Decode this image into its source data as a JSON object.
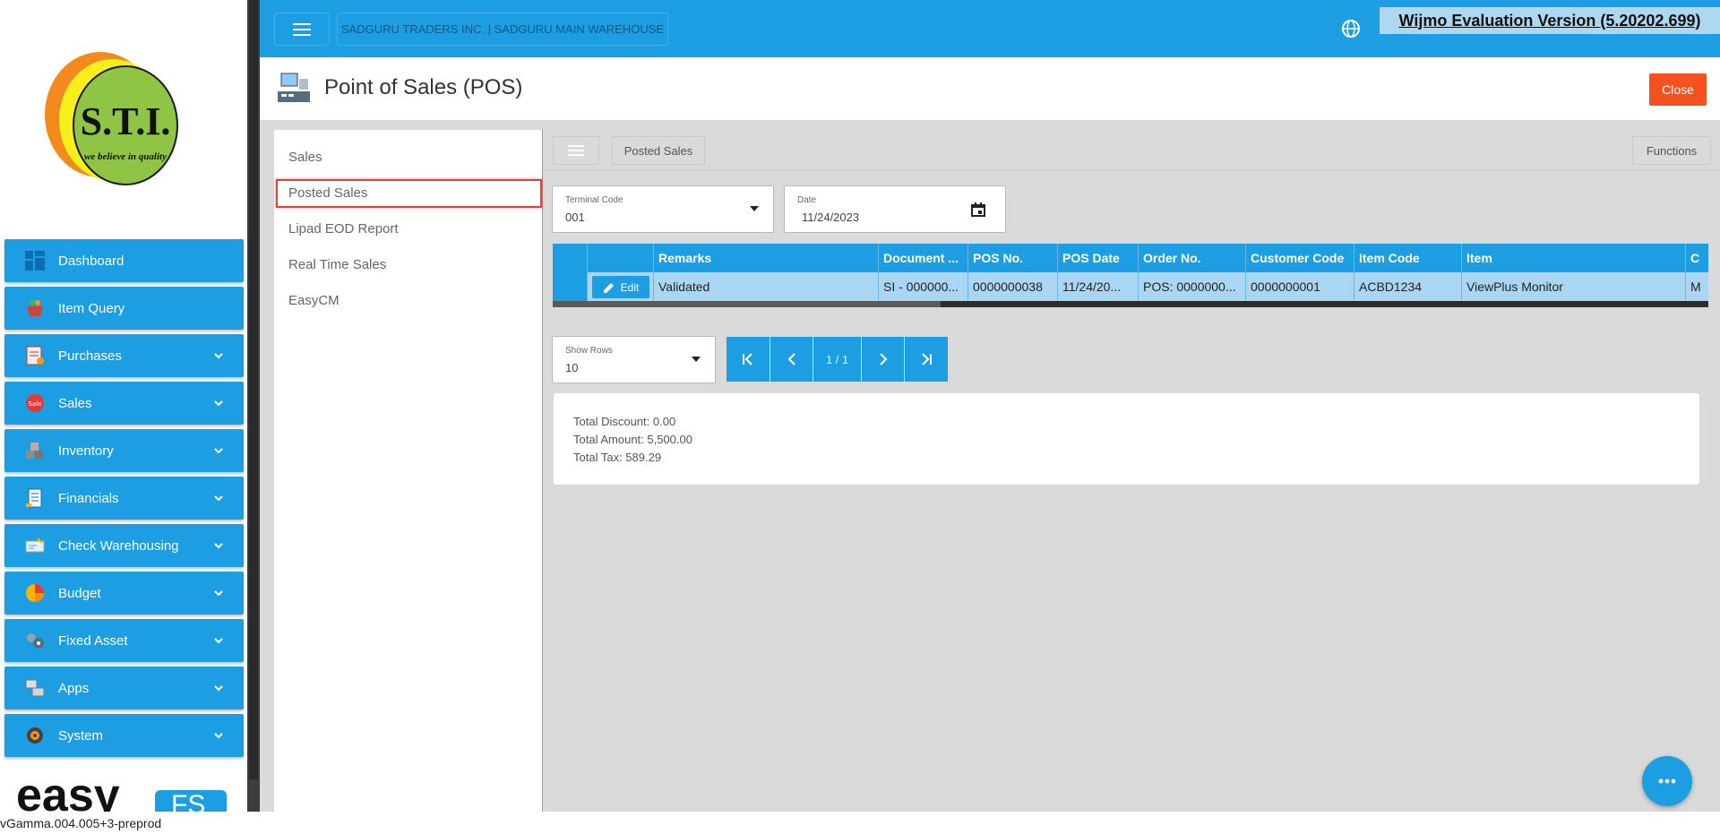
{
  "sidebar": {
    "logo_text": "S.T.I.",
    "logo_tagline": "we believe in quality",
    "items": [
      {
        "label": "Dashboard",
        "icon": "dashboard-icon",
        "has_chevron": false
      },
      {
        "label": "Item Query",
        "icon": "basket-icon",
        "has_chevron": false
      },
      {
        "label": "Purchases",
        "icon": "purchases-icon",
        "has_chevron": true
      },
      {
        "label": "Sales",
        "icon": "sale-tag-icon",
        "has_chevron": true
      },
      {
        "label": "Inventory",
        "icon": "boxes-icon",
        "has_chevron": true
      },
      {
        "label": "Financials",
        "icon": "ledger-icon",
        "has_chevron": true
      },
      {
        "label": "Check Warehousing",
        "icon": "check-icon",
        "has_chevron": true
      },
      {
        "label": "Budget",
        "icon": "pie-chart-icon",
        "has_chevron": true
      },
      {
        "label": "Fixed Asset",
        "icon": "gears-icon",
        "has_chevron": true
      },
      {
        "label": "Apps",
        "icon": "apps-icon",
        "has_chevron": true
      },
      {
        "label": "System",
        "icon": "settings-icon",
        "has_chevron": true
      }
    ],
    "bottom_logo_text": "easy",
    "bottom_logo_badge": "FS"
  },
  "topbar": {
    "company": "SADGURU TRADERS INC. | SADGURU MAIN WAREHOUSE",
    "watermark": "Wijmo Evaluation Version (5.20202.699)"
  },
  "page": {
    "title": "Point of Sales (POS)",
    "close_label": "Close"
  },
  "subnav": {
    "items": [
      "Sales",
      "Posted Sales",
      "Lipad EOD Report",
      "Real Time Sales",
      "EasyCM"
    ],
    "selected": "Posted Sales"
  },
  "toolbar": {
    "breadcrumb": "Posted Sales",
    "functions_label": "Functions"
  },
  "filters": {
    "terminal_label": "Terminal Code",
    "terminal_value": "001",
    "date_label": "Date",
    "date_value": "11/24/2023"
  },
  "grid": {
    "columns": [
      "",
      "",
      "Remarks",
      "Document ...",
      "POS No.",
      "POS Date",
      "Order No.",
      "Customer Code",
      "Item Code",
      "Item",
      "C"
    ],
    "rows": [
      {
        "edit_label": "Edit",
        "cells": [
          "Validated",
          "SI - 000000...",
          "0000000038",
          "11/24/20...",
          "POS: 0000000...",
          "0000000001",
          "ACBD1234",
          "ViewPlus Monitor",
          "M"
        ]
      }
    ]
  },
  "pager": {
    "show_rows_label": "Show Rows",
    "show_rows_value": "10",
    "page_indicator": "1 / 1"
  },
  "totals": {
    "discount": "Total Discount: 0.00",
    "amount": "Total Amount: 5,500.00",
    "tax": "Total Tax: 589.29"
  },
  "footer": {
    "version": "vGamma.004.005+3-preprod"
  },
  "colors": {
    "primary": "#1d9ee3",
    "close": "#f4511e",
    "selection": "#e0413a",
    "row_selected": "#a9d7f3"
  }
}
